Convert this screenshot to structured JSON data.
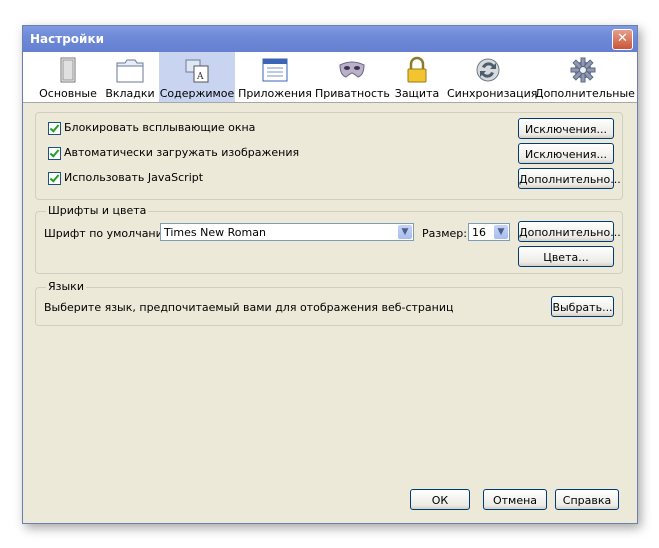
{
  "window": {
    "title": "Настройки",
    "close_glyph": "✕"
  },
  "toolbar": [
    {
      "label": "Основные",
      "icon": "general-icon"
    },
    {
      "label": "Вкладки",
      "icon": "tabs-icon"
    },
    {
      "label": "Содержимое",
      "icon": "content-icon"
    },
    {
      "label": "Приложения",
      "icon": "applications-icon"
    },
    {
      "label": "Приватность",
      "icon": "privacy-mask-icon"
    },
    {
      "label": "Защита",
      "icon": "lock-icon"
    },
    {
      "label": "Синхронизация",
      "icon": "sync-icon"
    },
    {
      "label": "Дополнительные",
      "icon": "gear-icon"
    }
  ],
  "selected_tab": "Содержимое",
  "content": {
    "block_popups": {
      "label": "Блокировать всплывающие окна",
      "checked": true,
      "button": "Исключения..."
    },
    "load_images": {
      "label": "Автоматически загружать изображения",
      "checked": true,
      "button": "Исключения..."
    },
    "javascript": {
      "label": "Использовать JavaScript",
      "checked": true,
      "button": "Дополнительно..."
    }
  },
  "fonts": {
    "group_label": "Шрифты и цвета",
    "default_font_label": "Шрифт по умолчанию:",
    "default_font_value": "Times New Roman",
    "size_label": "Размер:",
    "size_value": "16",
    "advanced_button": "Дополнительно...",
    "colors_button": "Цвета..."
  },
  "languages": {
    "group_label": "Языки",
    "description": "Выберите язык, предпочитаемый вами для отображения веб-страниц",
    "choose_button": "Выбрать..."
  },
  "footer": {
    "ok": "ОК",
    "cancel": "Отмена",
    "help": "Справка"
  }
}
